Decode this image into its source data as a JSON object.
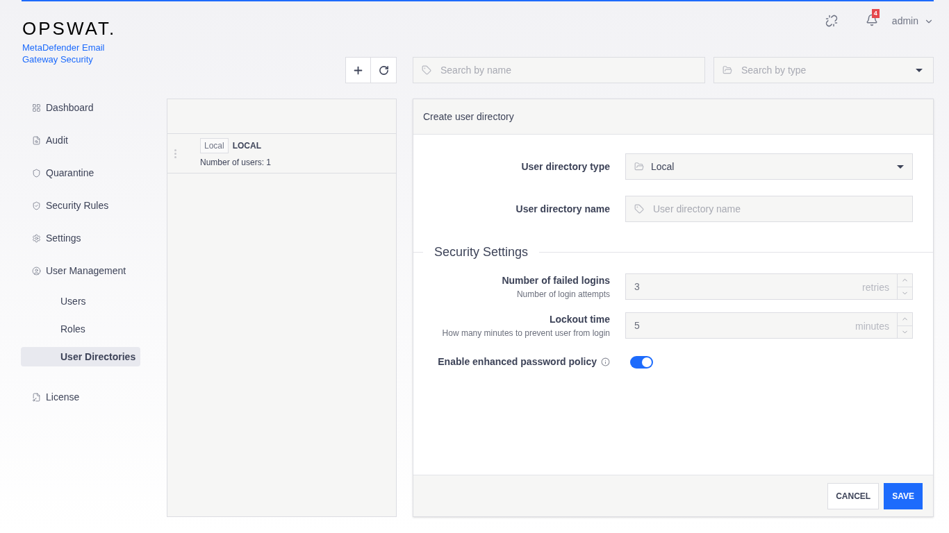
{
  "header": {
    "logo": "OPSWAT.",
    "product": "MetaDefender Email Gateway Security",
    "notification_count": "4",
    "user": "admin"
  },
  "sidebar": {
    "items": [
      {
        "label": "Dashboard",
        "selected": false
      },
      {
        "label": "Audit",
        "selected": false
      },
      {
        "label": "Quarantine",
        "selected": false
      },
      {
        "label": "Security Rules",
        "selected": false
      },
      {
        "label": "Settings",
        "selected": false
      },
      {
        "label": "User Management",
        "selected": false,
        "children": [
          {
            "label": "Users",
            "selected": false
          },
          {
            "label": "Roles",
            "selected": false
          },
          {
            "label": "User Directories",
            "selected": true
          }
        ]
      },
      {
        "label": "License",
        "selected": false
      }
    ]
  },
  "toolbar": {
    "search_name": {
      "placeholder": "Search by name"
    },
    "search_type": {
      "placeholder": "Search by type"
    }
  },
  "directories": [
    {
      "tag": "Local",
      "name": "LOCAL",
      "users": "Number of users: 1"
    }
  ],
  "form": {
    "title": "Create user directory",
    "type_label": "User directory type",
    "type_value": "Local",
    "name_label": "User directory name",
    "name_placeholder": "User directory name",
    "section": "Security Settings",
    "numbers": [
      {
        "label": "Number of failed logins",
        "hint": "Number of login attempts",
        "value": "3",
        "unit": "retries"
      },
      {
        "label": "Lockout time",
        "hint": "How many minutes to prevent user from login",
        "value": "5",
        "unit": "minutes"
      }
    ],
    "policy": {
      "label": "Enable enhanced password policy",
      "on": true
    },
    "buttons": {
      "cancel": "CANCEL",
      "save": "SAVE"
    }
  }
}
